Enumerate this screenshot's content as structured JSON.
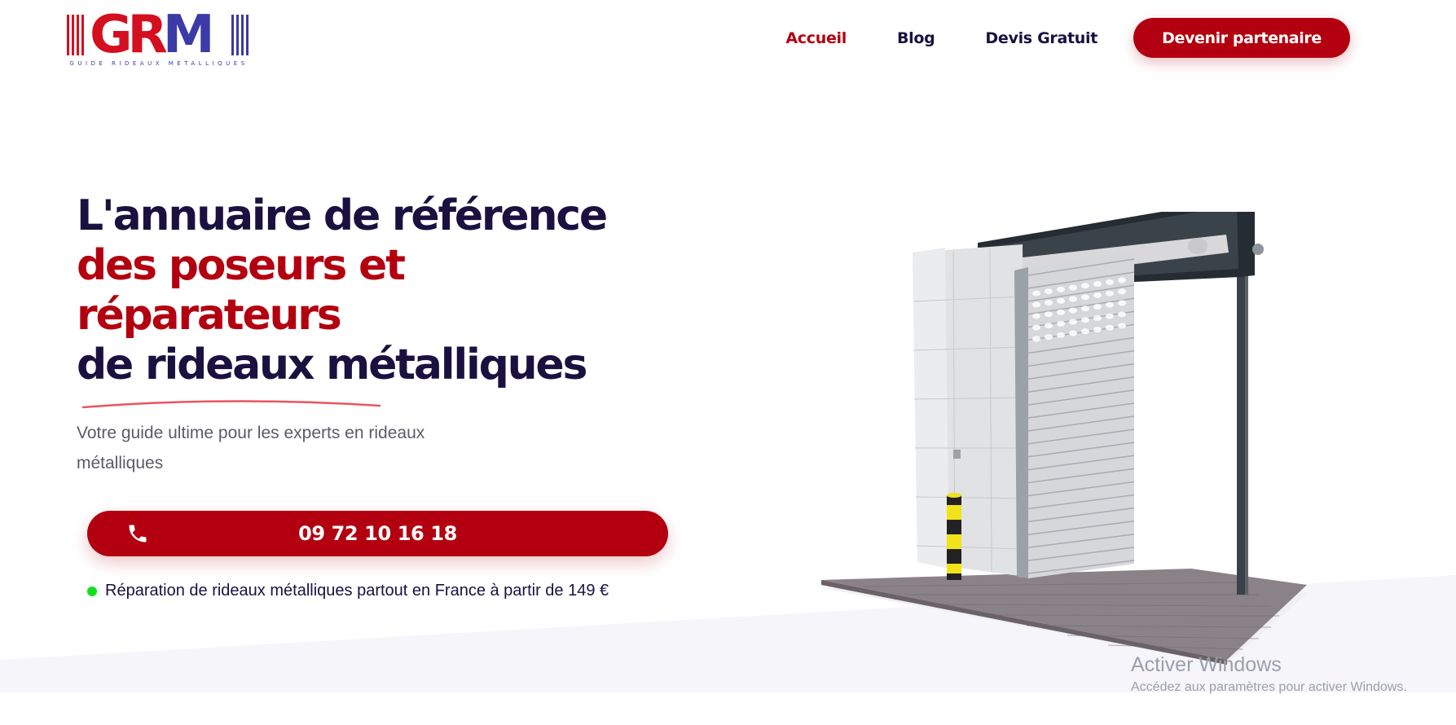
{
  "header": {
    "logo": {
      "letters_gr": "GR",
      "letters_m": "M",
      "tagline": "GUIDE RIDEAUX MÉTALLIQUES"
    },
    "nav": [
      {
        "label": "Accueil",
        "active": true
      },
      {
        "label": "Blog",
        "active": false
      },
      {
        "label": "Devis Gratuit",
        "active": false
      }
    ],
    "cta_label": "Devenir partenaire"
  },
  "hero": {
    "title_line1": "L'annuaire de référence",
    "title_line2": "des poseurs et",
    "title_line3": "réparateurs",
    "title_line4": "de rideaux métalliques",
    "subtitle": "Votre guide ultime pour les experts en rideaux métalliques",
    "phone_icon": "phone-icon",
    "phone_number": "09 72 10 16 18",
    "note": "Réparation de rideaux métalliques partout en France à partir de 149 €"
  },
  "illustration": {
    "subject": "metal-roller-shutter-icon"
  },
  "watermark": {
    "title": "Activer Windows",
    "subtitle": "Accédez aux paramètres pour activer Windows."
  },
  "colors": {
    "brand_red": "#b30010",
    "navy": "#1a1140",
    "logo_blue": "#3b3aa6",
    "status_green": "#13e01b",
    "wave": "#f5f5fa"
  }
}
